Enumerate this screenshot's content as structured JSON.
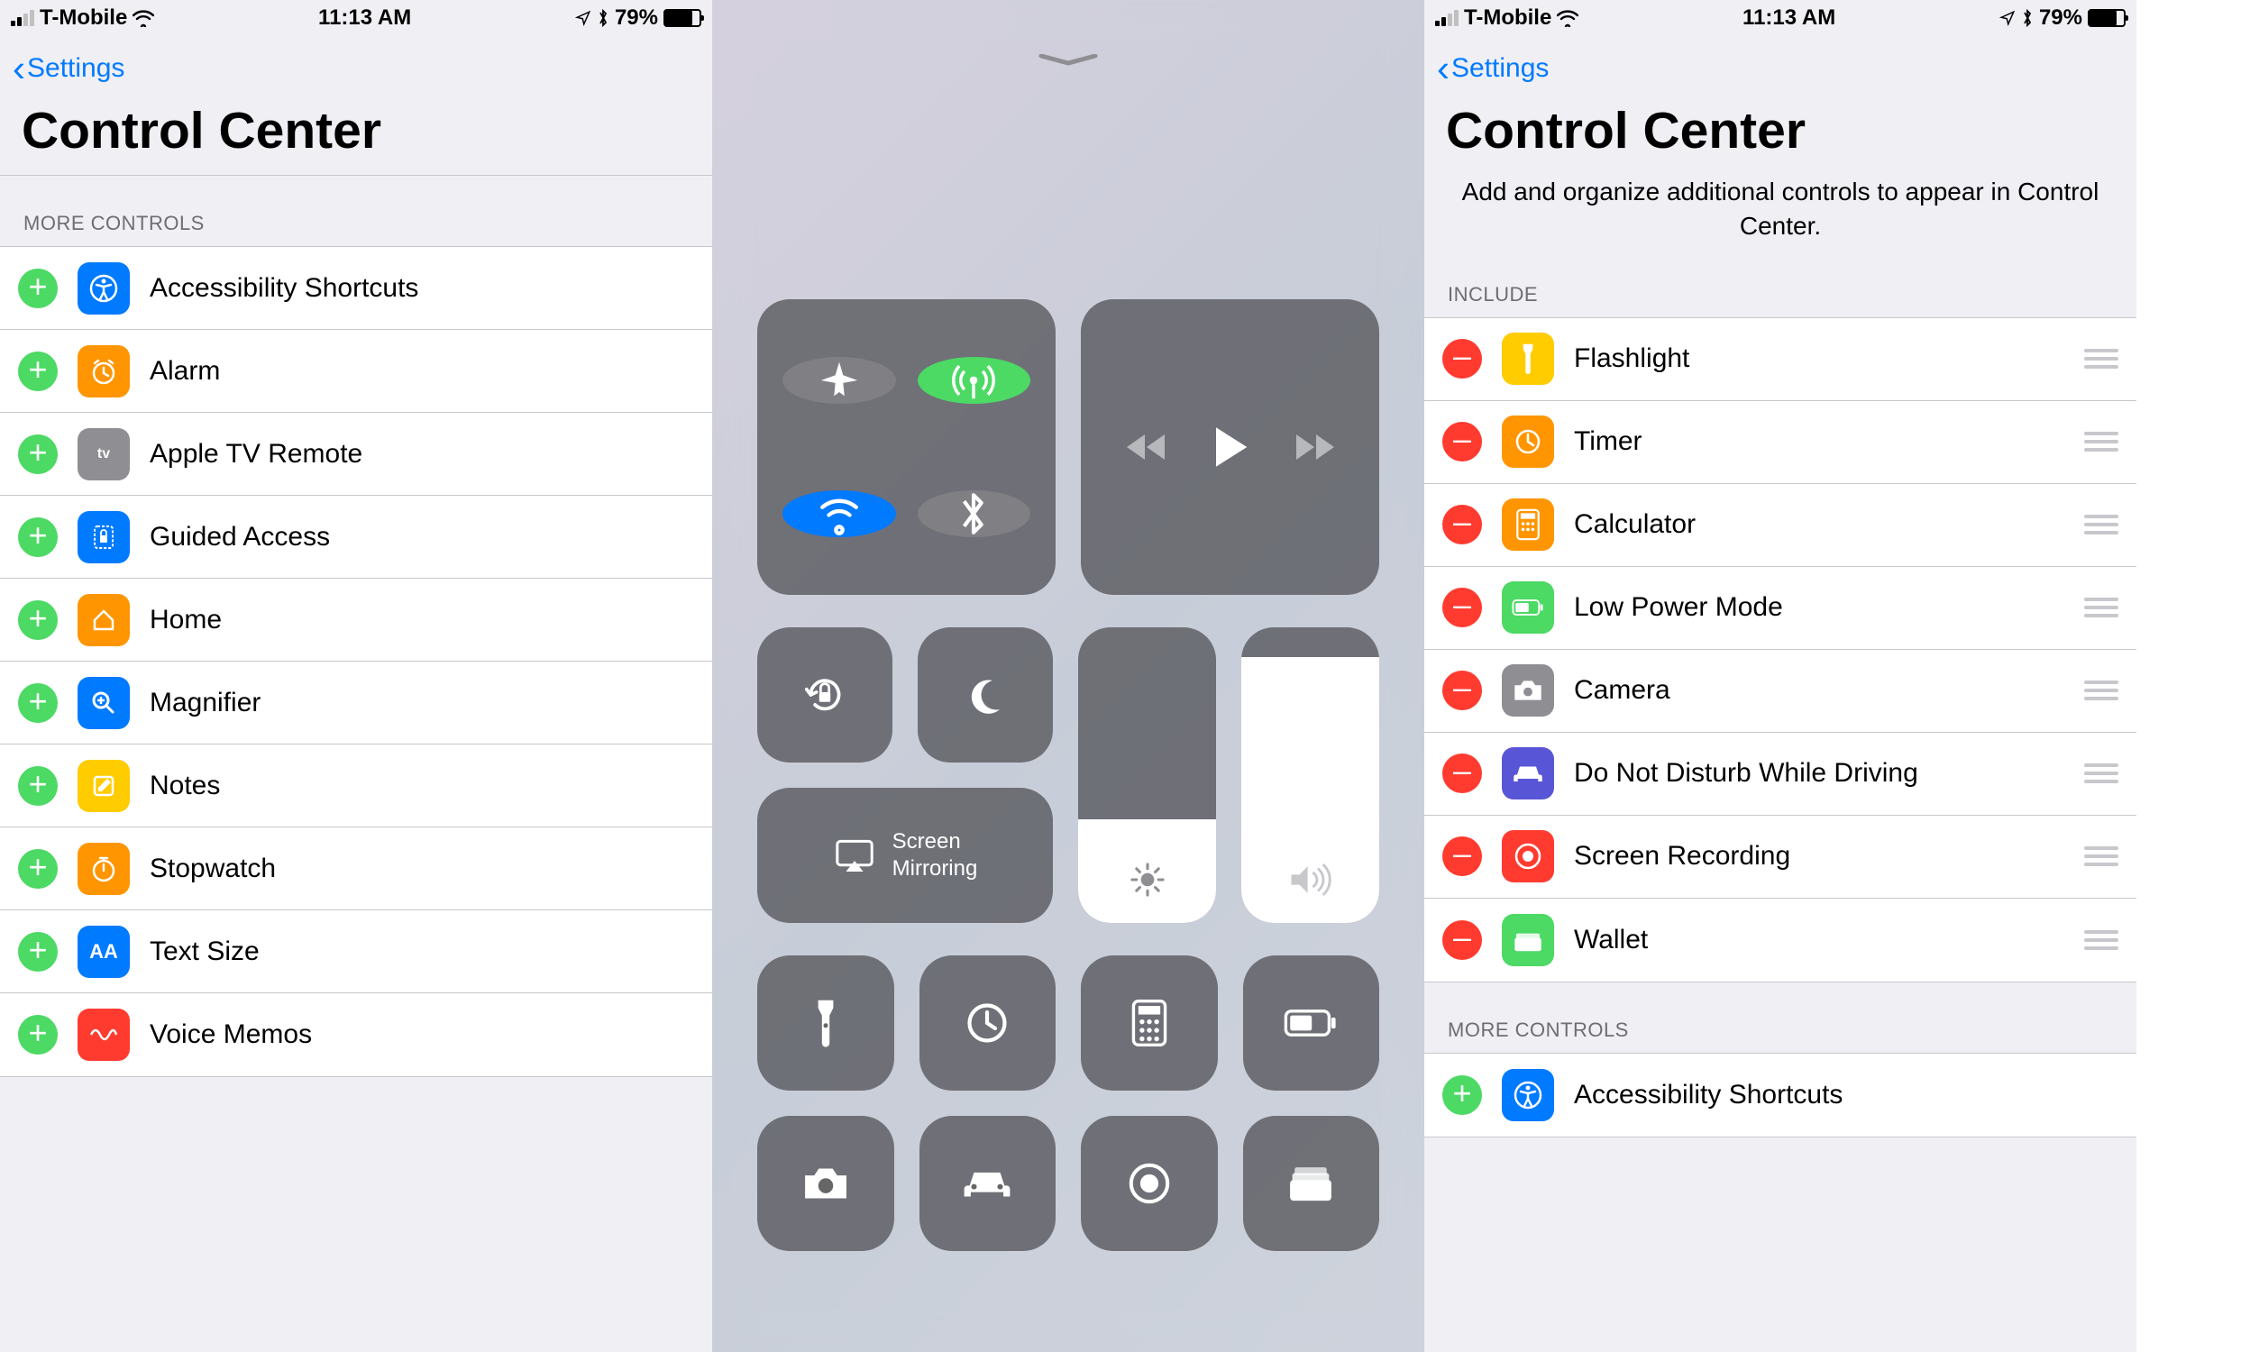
{
  "status": {
    "carrier": "T-Mobile",
    "time": "11:13 AM",
    "battery_pct": "79%"
  },
  "back_label": "Settings",
  "title": "Control Center",
  "right_subtitle": "Add and organize additional controls to appear in Control Center.",
  "left": {
    "section": "MORE CONTROLS",
    "items": [
      {
        "label": "Accessibility Shortcuts"
      },
      {
        "label": "Alarm"
      },
      {
        "label": "Apple TV Remote"
      },
      {
        "label": "Guided Access"
      },
      {
        "label": "Home"
      },
      {
        "label": "Magnifier"
      },
      {
        "label": "Notes"
      },
      {
        "label": "Stopwatch"
      },
      {
        "label": "Text Size"
      },
      {
        "label": "Voice Memos"
      }
    ]
  },
  "right": {
    "section_include": "INCLUDE",
    "section_more": "MORE CONTROLS",
    "include_items": [
      {
        "label": "Flashlight"
      },
      {
        "label": "Timer"
      },
      {
        "label": "Calculator"
      },
      {
        "label": "Low Power Mode"
      },
      {
        "label": "Camera"
      },
      {
        "label": "Do Not Disturb While Driving"
      },
      {
        "label": "Screen Recording"
      },
      {
        "label": "Wallet"
      }
    ],
    "more_items": [
      {
        "label": "Accessibility Shortcuts"
      }
    ]
  },
  "cc": {
    "screen_mirroring": "Screen\nMirroring"
  }
}
